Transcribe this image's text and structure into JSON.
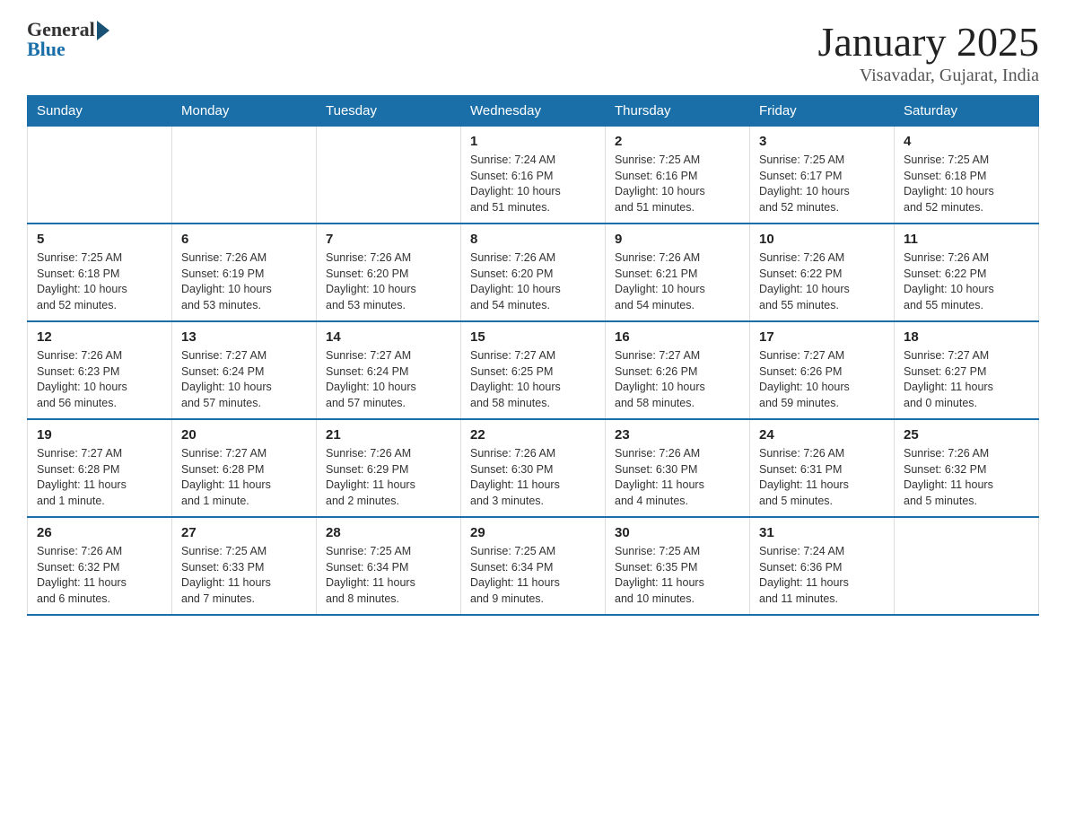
{
  "header": {
    "logo_general": "General",
    "logo_blue": "Blue",
    "month_title": "January 2025",
    "location": "Visavadar, Gujarat, India"
  },
  "weekdays": [
    "Sunday",
    "Monday",
    "Tuesday",
    "Wednesday",
    "Thursday",
    "Friday",
    "Saturday"
  ],
  "weeks": [
    [
      {
        "day": "",
        "info": ""
      },
      {
        "day": "",
        "info": ""
      },
      {
        "day": "",
        "info": ""
      },
      {
        "day": "1",
        "info": "Sunrise: 7:24 AM\nSunset: 6:16 PM\nDaylight: 10 hours\nand 51 minutes."
      },
      {
        "day": "2",
        "info": "Sunrise: 7:25 AM\nSunset: 6:16 PM\nDaylight: 10 hours\nand 51 minutes."
      },
      {
        "day": "3",
        "info": "Sunrise: 7:25 AM\nSunset: 6:17 PM\nDaylight: 10 hours\nand 52 minutes."
      },
      {
        "day": "4",
        "info": "Sunrise: 7:25 AM\nSunset: 6:18 PM\nDaylight: 10 hours\nand 52 minutes."
      }
    ],
    [
      {
        "day": "5",
        "info": "Sunrise: 7:25 AM\nSunset: 6:18 PM\nDaylight: 10 hours\nand 52 minutes."
      },
      {
        "day": "6",
        "info": "Sunrise: 7:26 AM\nSunset: 6:19 PM\nDaylight: 10 hours\nand 53 minutes."
      },
      {
        "day": "7",
        "info": "Sunrise: 7:26 AM\nSunset: 6:20 PM\nDaylight: 10 hours\nand 53 minutes."
      },
      {
        "day": "8",
        "info": "Sunrise: 7:26 AM\nSunset: 6:20 PM\nDaylight: 10 hours\nand 54 minutes."
      },
      {
        "day": "9",
        "info": "Sunrise: 7:26 AM\nSunset: 6:21 PM\nDaylight: 10 hours\nand 54 minutes."
      },
      {
        "day": "10",
        "info": "Sunrise: 7:26 AM\nSunset: 6:22 PM\nDaylight: 10 hours\nand 55 minutes."
      },
      {
        "day": "11",
        "info": "Sunrise: 7:26 AM\nSunset: 6:22 PM\nDaylight: 10 hours\nand 55 minutes."
      }
    ],
    [
      {
        "day": "12",
        "info": "Sunrise: 7:26 AM\nSunset: 6:23 PM\nDaylight: 10 hours\nand 56 minutes."
      },
      {
        "day": "13",
        "info": "Sunrise: 7:27 AM\nSunset: 6:24 PM\nDaylight: 10 hours\nand 57 minutes."
      },
      {
        "day": "14",
        "info": "Sunrise: 7:27 AM\nSunset: 6:24 PM\nDaylight: 10 hours\nand 57 minutes."
      },
      {
        "day": "15",
        "info": "Sunrise: 7:27 AM\nSunset: 6:25 PM\nDaylight: 10 hours\nand 58 minutes."
      },
      {
        "day": "16",
        "info": "Sunrise: 7:27 AM\nSunset: 6:26 PM\nDaylight: 10 hours\nand 58 minutes."
      },
      {
        "day": "17",
        "info": "Sunrise: 7:27 AM\nSunset: 6:26 PM\nDaylight: 10 hours\nand 59 minutes."
      },
      {
        "day": "18",
        "info": "Sunrise: 7:27 AM\nSunset: 6:27 PM\nDaylight: 11 hours\nand 0 minutes."
      }
    ],
    [
      {
        "day": "19",
        "info": "Sunrise: 7:27 AM\nSunset: 6:28 PM\nDaylight: 11 hours\nand 1 minute."
      },
      {
        "day": "20",
        "info": "Sunrise: 7:27 AM\nSunset: 6:28 PM\nDaylight: 11 hours\nand 1 minute."
      },
      {
        "day": "21",
        "info": "Sunrise: 7:26 AM\nSunset: 6:29 PM\nDaylight: 11 hours\nand 2 minutes."
      },
      {
        "day": "22",
        "info": "Sunrise: 7:26 AM\nSunset: 6:30 PM\nDaylight: 11 hours\nand 3 minutes."
      },
      {
        "day": "23",
        "info": "Sunrise: 7:26 AM\nSunset: 6:30 PM\nDaylight: 11 hours\nand 4 minutes."
      },
      {
        "day": "24",
        "info": "Sunrise: 7:26 AM\nSunset: 6:31 PM\nDaylight: 11 hours\nand 5 minutes."
      },
      {
        "day": "25",
        "info": "Sunrise: 7:26 AM\nSunset: 6:32 PM\nDaylight: 11 hours\nand 5 minutes."
      }
    ],
    [
      {
        "day": "26",
        "info": "Sunrise: 7:26 AM\nSunset: 6:32 PM\nDaylight: 11 hours\nand 6 minutes."
      },
      {
        "day": "27",
        "info": "Sunrise: 7:25 AM\nSunset: 6:33 PM\nDaylight: 11 hours\nand 7 minutes."
      },
      {
        "day": "28",
        "info": "Sunrise: 7:25 AM\nSunset: 6:34 PM\nDaylight: 11 hours\nand 8 minutes."
      },
      {
        "day": "29",
        "info": "Sunrise: 7:25 AM\nSunset: 6:34 PM\nDaylight: 11 hours\nand 9 minutes."
      },
      {
        "day": "30",
        "info": "Sunrise: 7:25 AM\nSunset: 6:35 PM\nDaylight: 11 hours\nand 10 minutes."
      },
      {
        "day": "31",
        "info": "Sunrise: 7:24 AM\nSunset: 6:36 PM\nDaylight: 11 hours\nand 11 minutes."
      },
      {
        "day": "",
        "info": ""
      }
    ]
  ]
}
